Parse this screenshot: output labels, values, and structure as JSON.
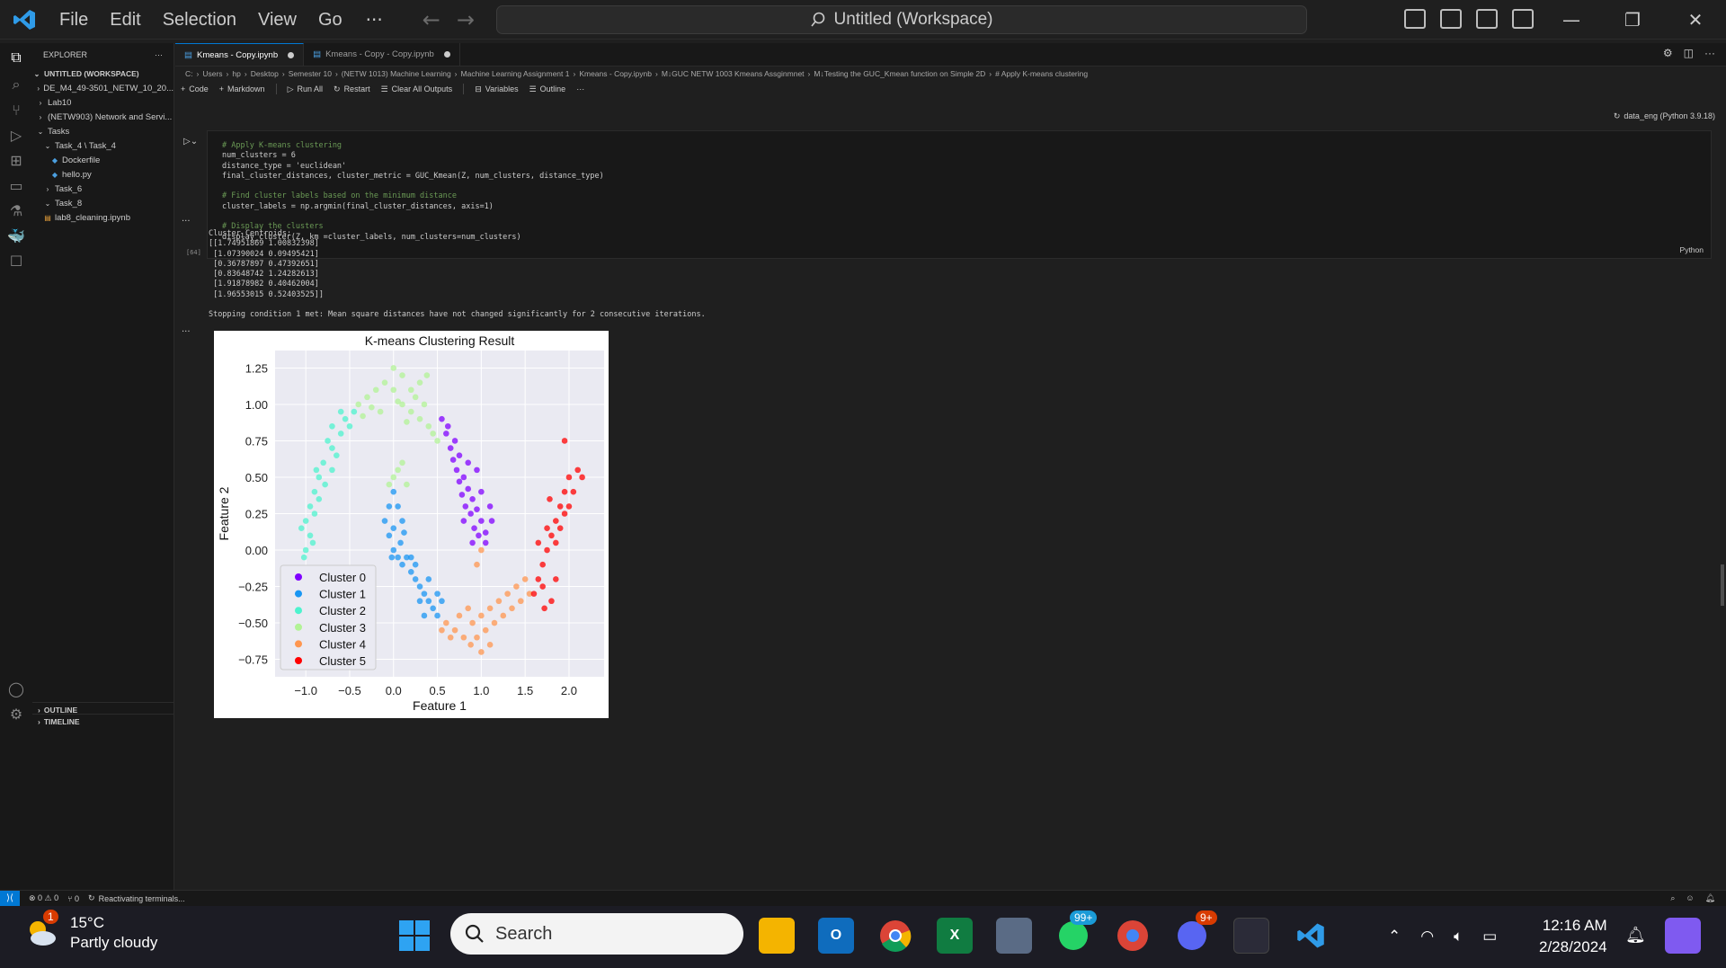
{
  "window": {
    "menu": [
      "File",
      "Edit",
      "Selection",
      "View",
      "Go"
    ],
    "more": "···",
    "command_center": "Untitled (Workspace)"
  },
  "sidebar": {
    "header": "EXPLORER",
    "more": "···",
    "workspace": "UNTITLED (WORKSPACE)",
    "items": [
      {
        "label": "DE_M4_49-3501_NETW_10_20...",
        "chev": "›"
      },
      {
        "label": "Lab10",
        "chev": "›"
      },
      {
        "label": "(NETW903) Network and Servi...",
        "chev": "›"
      },
      {
        "label": "Tasks",
        "chev": "⌄"
      },
      {
        "label": "Task_4 \\ Task_4",
        "chev": "⌄"
      },
      {
        "label": "Dockerfile",
        "chev": ""
      },
      {
        "label": "hello.py",
        "chev": ""
      },
      {
        "label": "Task_6",
        "chev": "›"
      },
      {
        "label": "Task_8",
        "chev": "⌄"
      },
      {
        "label": "lab8_cleaning.ipynb",
        "chev": ""
      }
    ],
    "outline": "OUTLINE",
    "timeline": "TIMELINE"
  },
  "tabs": [
    {
      "label": "Kmeans - Copy.ipynb",
      "active": true
    },
    {
      "label": "Kmeans - Copy - Copy.ipynb",
      "active": false
    }
  ],
  "breadcrumb": [
    "C:",
    "Users",
    "hp",
    "Desktop",
    "Semester 10",
    "(NETW 1013) Machine Learning",
    "Machine Learning Assignment 1",
    "Kmeans - Copy.ipynb",
    "M↓GUC NETW 1003 Kmeans Assginmnet",
    "M↓Testing the GUC_Kmean function on Simple 2D",
    "# Apply K-means clustering"
  ],
  "toolbar": {
    "code": "Code",
    "markdown": "Markdown",
    "run_all": "Run All",
    "restart": "Restart",
    "clear": "Clear All Outputs",
    "variables": "Variables",
    "outline": "Outline",
    "more": "···",
    "kernel": "data_eng (Python 3.9.18)"
  },
  "cell": {
    "exec_count": "[64]",
    "language": "Python",
    "lines": [
      {
        "c": "# Apply K-means clustering",
        "t": "comment"
      },
      {
        "c": "num_clusters = 6",
        "t": "plain"
      },
      {
        "c": "distance_type = 'euclidean'",
        "t": "str"
      },
      {
        "c": "final_cluster_distances, cluster_metric = GUC_Kmean(Z, num_clusters, distance_type)",
        "t": "plain"
      },
      {
        "c": "",
        "t": "plain"
      },
      {
        "c": "# Find cluster labels based on the minimum distance",
        "t": "comment"
      },
      {
        "c": "cluster_labels = np.argmin(final_cluster_distances, axis=1)",
        "t": "plain"
      },
      {
        "c": "",
        "t": "plain"
      },
      {
        "c": "# Display the clusters",
        "t": "comment"
      },
      {
        "c": "display_cluster(Z, km =cluster_labels, num_clusters=num_clusters)",
        "t": "plain"
      }
    ]
  },
  "output": {
    "lines": [
      "Cluster_Centroids:",
      "[[1.74951869 1.00832398]",
      " [1.07390024 0.09495421]",
      " [0.36787897 0.47392651]",
      " [0.83648742 1.24282613]",
      " [1.91878982 0.40462004]",
      " [1.96553015 0.52403525]]",
      "",
      "Stopping condition 1 met: Mean square distances have not changed significantly for 2 consecutive iterations."
    ]
  },
  "chart_data": {
    "type": "scatter",
    "title": "K-means Clustering Result",
    "xlabel": "Feature 1",
    "ylabel": "Feature 2",
    "xlim": [
      -1.35,
      2.4
    ],
    "ylim": [
      -0.87,
      1.37
    ],
    "xticks": [
      "−1.0",
      "−0.5",
      "0.0",
      "0.5",
      "1.0",
      "1.5",
      "2.0"
    ],
    "xtick_values": [
      -1.0,
      -0.5,
      0.0,
      0.5,
      1.0,
      1.5,
      2.0
    ],
    "yticks": [
      "−0.75",
      "−0.50",
      "−0.25",
      "0.00",
      "0.25",
      "0.50",
      "0.75",
      "1.00",
      "1.25"
    ],
    "ytick_values": [
      -0.75,
      -0.5,
      -0.25,
      0.0,
      0.25,
      0.5,
      0.75,
      1.0,
      1.25
    ],
    "grid": true,
    "legend_position": "lower-left",
    "series": [
      {
        "name": "Cluster 0",
        "color": "#8000ff",
        "points": [
          [
            0.55,
            0.9
          ],
          [
            0.6,
            0.8
          ],
          [
            0.7,
            0.75
          ],
          [
            0.75,
            0.65
          ],
          [
            0.72,
            0.55
          ],
          [
            0.8,
            0.5
          ],
          [
            0.85,
            0.42
          ],
          [
            0.9,
            0.35
          ],
          [
            0.95,
            0.28
          ],
          [
            1.0,
            0.2
          ],
          [
            0.88,
            0.25
          ],
          [
            0.82,
            0.3
          ],
          [
            0.78,
            0.38
          ],
          [
            0.92,
            0.15
          ],
          [
            1.05,
            0.12
          ],
          [
            1.1,
            0.3
          ],
          [
            1.0,
            0.4
          ],
          [
            0.95,
            0.55
          ],
          [
            0.65,
            0.7
          ],
          [
            0.68,
            0.62
          ],
          [
            0.75,
            0.47
          ],
          [
            0.9,
            0.05
          ],
          [
            0.97,
            0.1
          ],
          [
            0.85,
            0.6
          ],
          [
            0.62,
            0.85
          ],
          [
            1.12,
            0.2
          ],
          [
            0.8,
            0.2
          ],
          [
            1.05,
            0.05
          ]
        ]
      },
      {
        "name": "Cluster 1",
        "color": "#1996f3",
        "points": [
          [
            0.0,
            0.4
          ],
          [
            -0.05,
            0.3
          ],
          [
            -0.1,
            0.2
          ],
          [
            -0.05,
            0.1
          ],
          [
            0.0,
            0.0
          ],
          [
            0.05,
            -0.05
          ],
          [
            0.1,
            -0.1
          ],
          [
            0.2,
            -0.15
          ],
          [
            0.25,
            -0.2
          ],
          [
            0.3,
            -0.25
          ],
          [
            0.35,
            -0.3
          ],
          [
            0.4,
            -0.35
          ],
          [
            0.45,
            -0.4
          ],
          [
            0.5,
            -0.45
          ],
          [
            0.3,
            -0.35
          ],
          [
            0.15,
            -0.05
          ],
          [
            0.08,
            0.05
          ],
          [
            0.0,
            0.15
          ],
          [
            0.1,
            0.2
          ],
          [
            0.2,
            -0.05
          ],
          [
            0.4,
            -0.2
          ],
          [
            0.5,
            -0.3
          ],
          [
            0.55,
            -0.35
          ],
          [
            0.35,
            -0.45
          ],
          [
            0.25,
            -0.1
          ],
          [
            0.05,
            0.3
          ],
          [
            0.12,
            0.12
          ],
          [
            -0.02,
            -0.05
          ]
        ]
      },
      {
        "name": "Cluster 2",
        "color": "#4df3ce",
        "points": [
          [
            -1.0,
            0.0
          ],
          [
            -0.95,
            0.1
          ],
          [
            -1.0,
            0.2
          ],
          [
            -0.95,
            0.3
          ],
          [
            -0.9,
            0.4
          ],
          [
            -0.85,
            0.5
          ],
          [
            -0.8,
            0.6
          ],
          [
            -0.7,
            0.7
          ],
          [
            -0.6,
            0.8
          ],
          [
            -0.55,
            0.9
          ],
          [
            -0.6,
            0.95
          ],
          [
            -0.7,
            0.85
          ],
          [
            -0.75,
            0.75
          ],
          [
            -0.85,
            0.35
          ],
          [
            -0.9,
            0.25
          ],
          [
            -1.05,
            0.15
          ],
          [
            -0.92,
            0.05
          ],
          [
            -0.65,
            0.65
          ],
          [
            -0.5,
            0.85
          ],
          [
            -0.45,
            0.95
          ],
          [
            -0.78,
            0.45
          ],
          [
            -0.88,
            0.55
          ],
          [
            -1.02,
            -0.05
          ],
          [
            -0.7,
            0.55
          ]
        ]
      },
      {
        "name": "Cluster 3",
        "color": "#b2f396",
        "points": [
          [
            -0.4,
            1.0
          ],
          [
            -0.3,
            1.05
          ],
          [
            -0.2,
            1.1
          ],
          [
            -0.1,
            1.15
          ],
          [
            0.0,
            1.1
          ],
          [
            0.1,
            1.0
          ],
          [
            0.2,
            0.95
          ],
          [
            0.3,
            0.9
          ],
          [
            0.4,
            0.85
          ],
          [
            0.45,
            0.8
          ],
          [
            0.35,
            1.0
          ],
          [
            0.25,
            1.05
          ],
          [
            0.1,
            1.2
          ],
          [
            0.0,
            1.25
          ],
          [
            -0.15,
            0.95
          ],
          [
            -0.25,
            0.98
          ],
          [
            0.05,
            0.55
          ],
          [
            0.0,
            0.5
          ],
          [
            0.15,
            0.45
          ],
          [
            0.2,
            1.1
          ],
          [
            0.3,
            1.15
          ],
          [
            0.38,
            1.2
          ],
          [
            -0.35,
            0.92
          ],
          [
            0.05,
            1.02
          ],
          [
            0.15,
            0.88
          ],
          [
            0.5,
            0.75
          ],
          [
            0.1,
            0.6
          ],
          [
            -0.05,
            0.45
          ]
        ]
      },
      {
        "name": "Cluster 4",
        "color": "#ff964f",
        "points": [
          [
            0.6,
            -0.5
          ],
          [
            0.7,
            -0.55
          ],
          [
            0.8,
            -0.6
          ],
          [
            0.9,
            -0.5
          ],
          [
            1.0,
            -0.45
          ],
          [
            1.1,
            -0.4
          ],
          [
            1.2,
            -0.35
          ],
          [
            1.3,
            -0.3
          ],
          [
            1.4,
            -0.25
          ],
          [
            1.5,
            -0.2
          ],
          [
            0.85,
            -0.4
          ],
          [
            0.95,
            -0.6
          ],
          [
            1.05,
            -0.55
          ],
          [
            1.15,
            -0.5
          ],
          [
            1.25,
            -0.45
          ],
          [
            0.75,
            -0.45
          ],
          [
            0.65,
            -0.6
          ],
          [
            1.0,
            -0.7
          ],
          [
            1.35,
            -0.4
          ],
          [
            1.45,
            -0.35
          ],
          [
            1.0,
            0.0
          ],
          [
            0.95,
            -0.1
          ],
          [
            1.55,
            -0.3
          ],
          [
            0.55,
            -0.55
          ],
          [
            1.1,
            -0.65
          ],
          [
            0.88,
            -0.65
          ]
        ]
      },
      {
        "name": "Cluster 5",
        "color": "#ff0000",
        "points": [
          [
            1.6,
            -0.3
          ],
          [
            1.65,
            -0.2
          ],
          [
            1.7,
            -0.1
          ],
          [
            1.75,
            0.0
          ],
          [
            1.8,
            0.1
          ],
          [
            1.85,
            0.2
          ],
          [
            1.9,
            0.3
          ],
          [
            1.95,
            0.4
          ],
          [
            2.0,
            0.5
          ],
          [
            2.1,
            0.55
          ],
          [
            1.95,
            0.25
          ],
          [
            1.85,
            0.05
          ],
          [
            1.7,
            -0.25
          ],
          [
            1.8,
            -0.35
          ],
          [
            1.9,
            0.15
          ],
          [
            2.05,
            0.4
          ],
          [
            1.75,
            0.15
          ],
          [
            1.65,
            0.05
          ],
          [
            1.95,
            0.75
          ],
          [
            1.85,
            -0.2
          ],
          [
            2.0,
            0.3
          ],
          [
            1.72,
            -0.4
          ],
          [
            2.15,
            0.5
          ],
          [
            1.78,
            0.35
          ]
        ]
      }
    ]
  },
  "statusbar": {
    "errors": "⊗ 0 ⚠ 0",
    "ports": "⑂ 0",
    "terminal": "Reactivating terminals..."
  },
  "taskbar": {
    "temp": "15°C",
    "condition": "Partly cloudy",
    "weather_badge": "1",
    "search": "Search",
    "whatsapp_badge": "99+",
    "discord_badge": "9+",
    "time": "12:16 AM",
    "date": "2/28/2024"
  }
}
